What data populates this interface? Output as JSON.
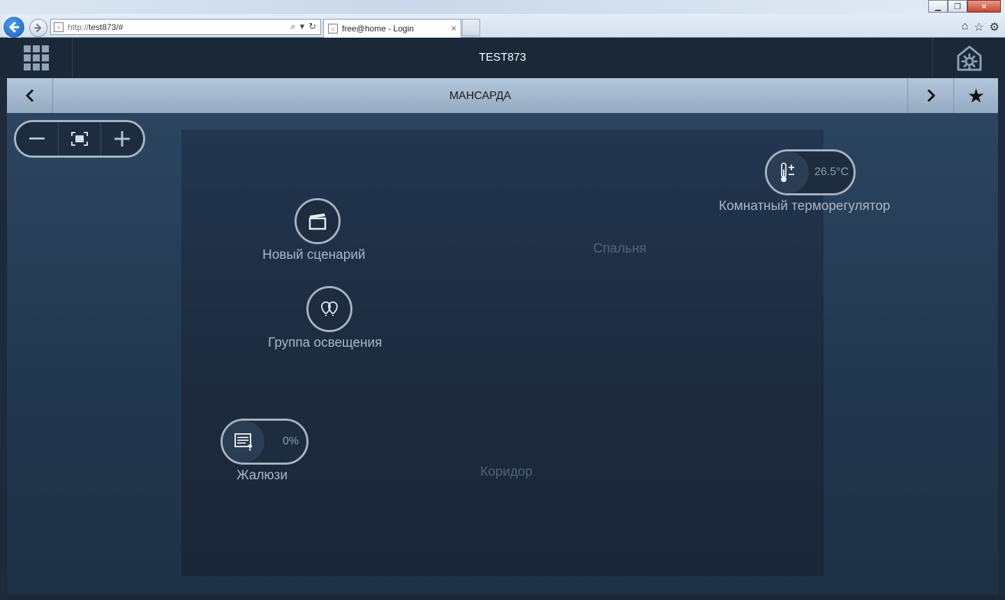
{
  "browser": {
    "url_protocol": "http://",
    "url_host": "test873/#",
    "tab_title": "free@home - Login",
    "tab_close": "×"
  },
  "header": {
    "title": "TEST873"
  },
  "floor_bar": {
    "title": "МАНСАРДА"
  },
  "rooms": {
    "bedroom": "Спальня",
    "corridor": "Коридор"
  },
  "devices": {
    "scene": {
      "label": "Новый сценарий",
      "icon": "scene-clapper-icon"
    },
    "light_group": {
      "label": "Группа освещения",
      "icon": "light-bulbs-icon"
    },
    "blinds": {
      "label": "Жалюзи",
      "value": "0%",
      "icon": "blinds-icon"
    },
    "thermostat": {
      "label": "Комнатный терморегулятор",
      "value": "26.5°C",
      "icon": "thermometer-icon"
    }
  },
  "colors": {
    "accent": "#a7b3c1",
    "header_bg": "#1a2838",
    "floor_bar_bg": "#a5bad0"
  }
}
